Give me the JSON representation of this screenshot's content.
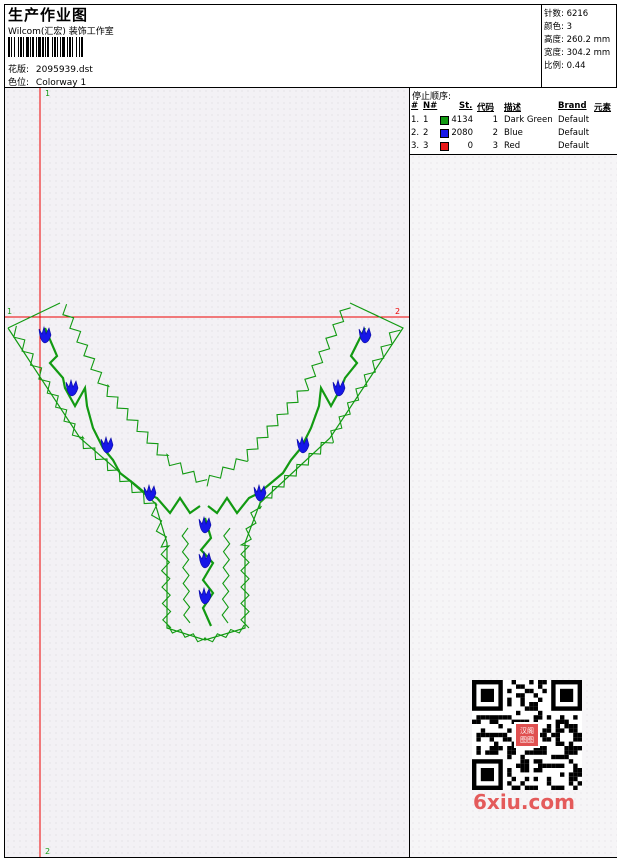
{
  "header": {
    "title": "生产作业图",
    "company": "Wilcom(汇宏) 装饰工作室",
    "design_label": "花版:",
    "design_value": "2095939.dst",
    "colorway_label": "色位:",
    "colorway_value": "Colorway 1"
  },
  "stats": [
    {
      "label": "针数:",
      "value": "6216"
    },
    {
      "label": "颜色:",
      "value": "3"
    },
    {
      "label": "高度:",
      "value": "260.2 mm"
    },
    {
      "label": "宽度:",
      "value": "304.2 mm"
    },
    {
      "label": "比例:",
      "value": "0.44"
    }
  ],
  "stop_sequence": {
    "title": "停止顺序:",
    "columns": [
      "#",
      "N#",
      "St.",
      "代码",
      "描述",
      "Brand",
      "元素"
    ],
    "rows": [
      {
        "num": "1.",
        "n": "1",
        "color": "#129a12",
        "stitches": "4134",
        "code": "1",
        "desc": "Dark Green",
        "brand": "Default"
      },
      {
        "num": "2.",
        "n": "2",
        "color": "#1717e8",
        "stitches": "2080",
        "code": "2",
        "desc": "Blue",
        "brand": "Default"
      },
      {
        "num": "3.",
        "n": "3",
        "color": "#e81717",
        "stitches": "0",
        "code": "3",
        "desc": "Red",
        "brand": "Default"
      }
    ]
  },
  "guides": {
    "v_top": "1",
    "v_bottom": "2",
    "h_left": "1",
    "h_right": "2"
  },
  "watermark": "6xiu.com",
  "qr_badge": "汉阁\n图图",
  "colors": {
    "green": "#129a12",
    "blue": "#1717e8",
    "red": "#e81717"
  }
}
